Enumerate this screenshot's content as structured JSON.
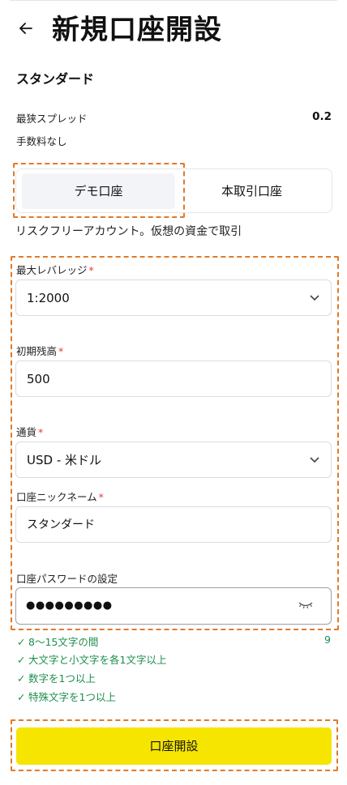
{
  "header": {
    "back_icon": "arrow-left-icon",
    "title": "新規口座開設"
  },
  "plan": {
    "name": "スタンダード"
  },
  "specs": {
    "spread_label": "最狭スプレッド",
    "spread_value": "0.2",
    "fee_label": "手数料なし"
  },
  "account_type": {
    "demo_label": "デモ口座",
    "real_label": "本取引口座",
    "selected": "demo"
  },
  "demo_description": "リスクフリーアカウント。仮想の資金で取引",
  "form": {
    "leverage": {
      "label": "最大レバレッジ",
      "required_mark": "*",
      "value": "1:2000"
    },
    "balance": {
      "label": "初期残高",
      "required_mark": "*",
      "value": "500"
    },
    "currency": {
      "label": "通貨",
      "required_mark": "*",
      "value": "USD - 米ドル"
    },
    "nickname": {
      "label": "口座ニックネーム",
      "required_mark": "*",
      "value": "スタンダード"
    },
    "password": {
      "label": "口座パスワードの設定",
      "value": "●●●●●●●●●"
    }
  },
  "password_rules": {
    "count": "9",
    "items": [
      "8～15文字の間",
      "大文字と小文字を各1文字以上",
      "数字を1つ以上",
      "特殊文字を1つ以上"
    ]
  },
  "submit": {
    "label": "口座開設",
    "color": "#f6e500"
  },
  "colors": {
    "highlight": "#e07a2b",
    "valid": "#1e8e4f",
    "required": "#e0403a"
  }
}
